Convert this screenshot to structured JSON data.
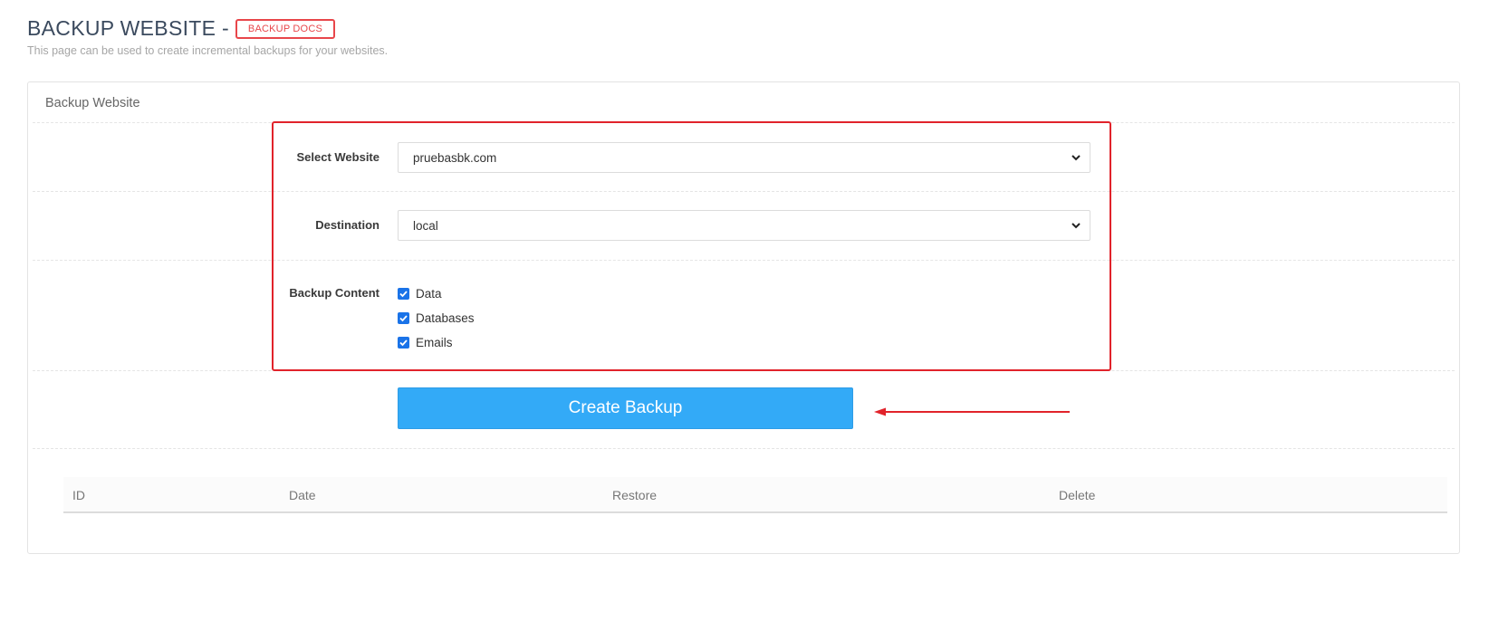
{
  "header": {
    "title": "BACKUP WEBSITE -",
    "docs_badge": "BACKUP DOCS",
    "subtitle": "This page can be used to create incremental backups for your websites."
  },
  "panel": {
    "title": "Backup Website"
  },
  "form": {
    "select_website_label": "Select Website",
    "select_website_value": "pruebasbk.com",
    "destination_label": "Destination",
    "destination_value": "local",
    "backup_content_label": "Backup Content",
    "options": [
      {
        "label": "Data",
        "checked": true
      },
      {
        "label": "Databases",
        "checked": true
      },
      {
        "label": "Emails",
        "checked": true
      }
    ],
    "create_button": "Create Backup"
  },
  "table": {
    "columns": [
      "ID",
      "Date",
      "Restore",
      "Delete"
    ],
    "rows": []
  },
  "colors": {
    "accent": "#33aaf7",
    "highlight": "#e1232b",
    "checkbox": "#1a73e8"
  },
  "icons": {
    "select_chevron": "chevron-down-icon",
    "checkbox_mark": "check-icon",
    "annotation": "arrow-left-icon"
  }
}
